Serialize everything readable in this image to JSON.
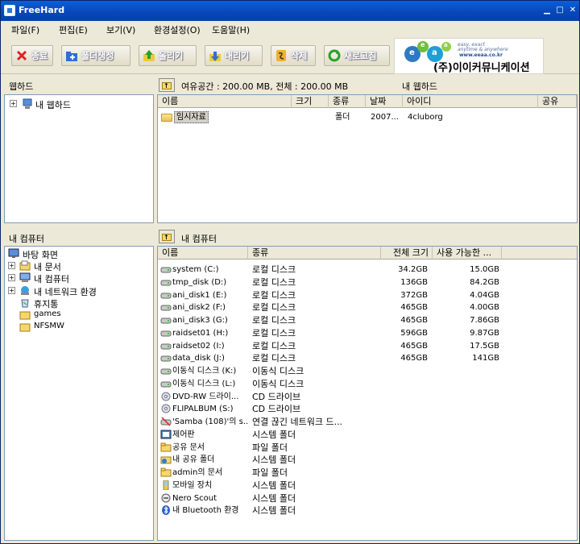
{
  "window": {
    "title": "FreeHard"
  },
  "menu": [
    "파일(F)",
    "편집(E)",
    "보기(V)",
    "환경설정(O)",
    "도움말(H)"
  ],
  "toolbar": {
    "exit": "종료",
    "new_folder": "폴더생성",
    "upload": "올리기",
    "download": "내리기",
    "delete": "삭제",
    "refresh": "새로고침"
  },
  "banner": {
    "line1": "easy, exact",
    "line2": "anytime & anywhere",
    "url": "www.eeaa.co.kr",
    "company": "(주)이이커뮤니케이션",
    "logo_letters": [
      "e",
      "e",
      "a",
      "a"
    ]
  },
  "webhard_panel": {
    "header": "웹하드",
    "tree": [
      {
        "label": "내 웹하드",
        "expander": "+"
      }
    ]
  },
  "remote": {
    "free_space": "여유공간 : 200.00 MB, 전체 : 200.00 MB",
    "location": "내 웹하드",
    "columns": [
      "이름",
      "크기",
      "종류",
      "날짜",
      "아이디",
      "공유"
    ],
    "rows": [
      {
        "name": "임시자료",
        "size": "",
        "type": "폴더",
        "date": "2007...",
        "owner": "4cluborg",
        "share": ""
      }
    ]
  },
  "computer_panel": {
    "header": "내 컴퓨터",
    "tree": [
      {
        "label": "바탕 화면",
        "expander": ""
      },
      {
        "label": "내 문서",
        "expander": "+"
      },
      {
        "label": "내 컴퓨터",
        "expander": "+"
      },
      {
        "label": "내 네트워크 환경",
        "expander": "+"
      },
      {
        "label": "휴지통",
        "expander": ""
      },
      {
        "label": "games",
        "expander": ""
      },
      {
        "label": "NFSMW",
        "expander": ""
      }
    ]
  },
  "local": {
    "location": "내 컴퓨터",
    "columns": [
      "이름",
      "종류",
      "전체 크기",
      "사용 가능한 ..."
    ],
    "rows": [
      {
        "name": "system (C:)",
        "type": "로컬 디스크",
        "total": "34.2GB",
        "free": "15.0GB",
        "icon": "drive"
      },
      {
        "name": "tmp_disk (D:)",
        "type": "로컬 디스크",
        "total": "136GB",
        "free": "84.2GB",
        "icon": "drive"
      },
      {
        "name": "ani_disk1 (E:)",
        "type": "로컬 디스크",
        "total": "372GB",
        "free": "4.04GB",
        "icon": "drive"
      },
      {
        "name": "ani_disk2 (F:)",
        "type": "로컬 디스크",
        "total": "465GB",
        "free": "4.00GB",
        "icon": "drive"
      },
      {
        "name": "ani_disk3 (G:)",
        "type": "로컬 디스크",
        "total": "465GB",
        "free": "7.86GB",
        "icon": "drive"
      },
      {
        "name": "raidset01 (H:)",
        "type": "로컬 디스크",
        "total": "596GB",
        "free": "9.87GB",
        "icon": "drive"
      },
      {
        "name": "raidset02 (I:)",
        "type": "로컬 디스크",
        "total": "465GB",
        "free": "17.5GB",
        "icon": "drive"
      },
      {
        "name": "data_disk (J:)",
        "type": "로컬 디스크",
        "total": "465GB",
        "free": "141GB",
        "icon": "drive"
      },
      {
        "name": "이동식 디스크 (K:)",
        "type": "이동식 디스크",
        "total": "",
        "free": "",
        "icon": "drive"
      },
      {
        "name": "이동식 디스크 (L:)",
        "type": "이동식 디스크",
        "total": "",
        "free": "",
        "icon": "drive"
      },
      {
        "name": "DVD-RW 드라이...",
        "type": "CD 드라이브",
        "total": "",
        "free": "",
        "icon": "cd"
      },
      {
        "name": "FLIPALBUM (S:)",
        "type": "CD 드라이브",
        "total": "",
        "free": "",
        "icon": "cd"
      },
      {
        "name": "'Samba (108)'의 s...",
        "type": "연결 끊긴 네트워크 드...",
        "total": "",
        "free": "",
        "icon": "net"
      },
      {
        "name": "제어판",
        "type": "시스템 폴더",
        "total": "",
        "free": "",
        "icon": "panel"
      },
      {
        "name": "공유 문서",
        "type": "파일 폴더",
        "total": "",
        "free": "",
        "icon": "folder"
      },
      {
        "name": "내 공유 폴더",
        "type": "시스템 폴더",
        "total": "",
        "free": "",
        "icon": "share"
      },
      {
        "name": "admin의 문서",
        "type": "파일 폴더",
        "total": "",
        "free": "",
        "icon": "folder"
      },
      {
        "name": "모바일 장치",
        "type": "시스템 폴더",
        "total": "",
        "free": "",
        "icon": "mobile"
      },
      {
        "name": "Nero Scout",
        "type": "시스템 폴더",
        "total": "",
        "free": "",
        "icon": "nero"
      },
      {
        "name": "내 Bluetooth 환경",
        "type": "시스템 폴더",
        "total": "",
        "free": "",
        "icon": "bt"
      }
    ]
  }
}
